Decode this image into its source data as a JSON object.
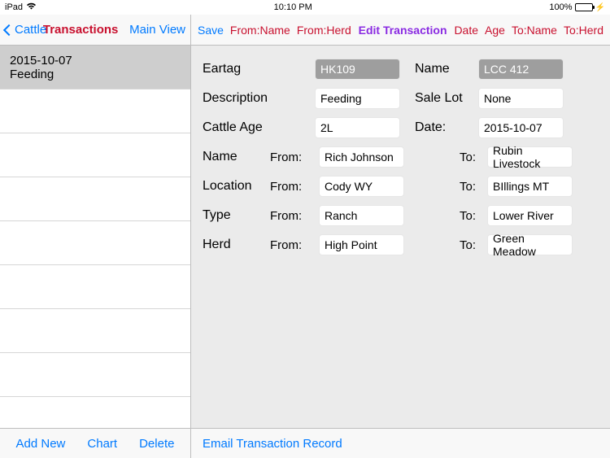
{
  "status": {
    "device": "iPad",
    "time": "10:10 PM",
    "battery_pct": "100%"
  },
  "sidebar": {
    "back_label": "Cattle",
    "title": "Transactions",
    "main_view": "Main View",
    "items": [
      {
        "date": "2015-10-07",
        "desc": "Feeding",
        "selected": true
      }
    ],
    "toolbar": {
      "add": "Add New",
      "chart": "Chart",
      "delete": "Delete"
    }
  },
  "detail": {
    "header": {
      "save": "Save",
      "from_name": "From:Name",
      "from_herd": "From:Herd",
      "title": "Edit Transaction",
      "date": "Date",
      "age": "Age",
      "to_name": "To:Name",
      "to_herd": "To:Herd"
    },
    "labels": {
      "eartag": "Eartag",
      "name": "Name",
      "description": "Description",
      "sale_lot": "Sale Lot",
      "cattle_age": "Cattle Age",
      "date": "Date:",
      "row_name": "Name",
      "location": "Location",
      "type": "Type",
      "herd": "Herd",
      "from": "From:",
      "to": "To:"
    },
    "fields": {
      "eartag": "HK109",
      "name": "LCC 412",
      "description": "Feeding",
      "sale_lot": "None",
      "cattle_age": "2L",
      "date": "2015-10-07",
      "name_from": "Rich Johnson",
      "name_to": "Rubin Livestock",
      "location_from": "Cody WY",
      "location_to": "BIllings MT",
      "type_from": "Ranch",
      "type_to": "Lower River",
      "herd_from": "High Point",
      "herd_to": "Green Meadow"
    },
    "toolbar": {
      "email": "Email Transaction Record"
    }
  }
}
